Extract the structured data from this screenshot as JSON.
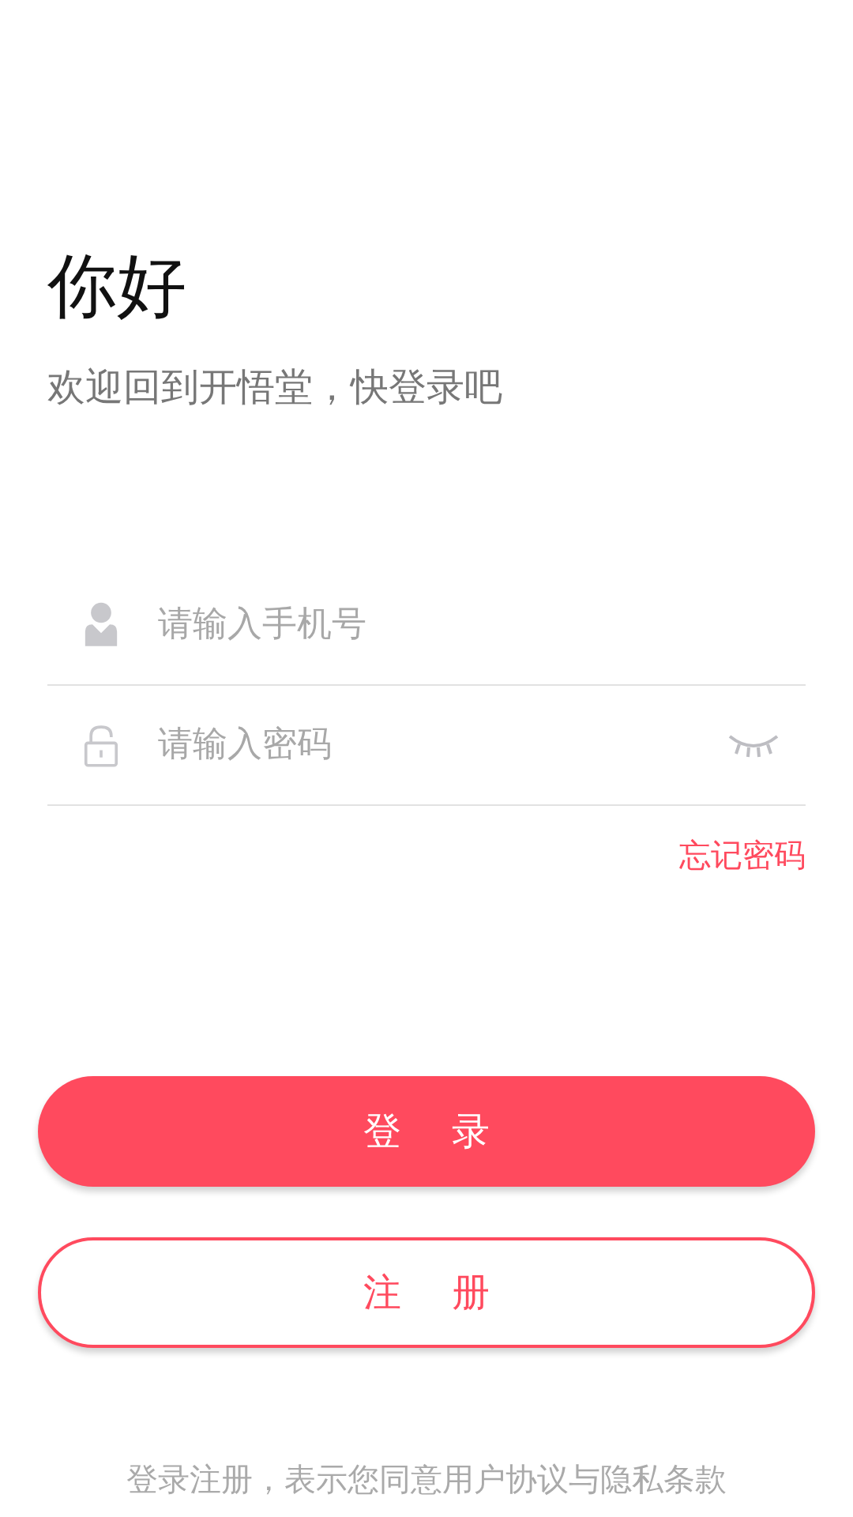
{
  "greeting": "你好",
  "subtitle": "欢迎回到开悟堂，快登录吧",
  "fields": [
    {
      "kind": "phone",
      "placeholder": "请输入手机号"
    },
    {
      "kind": "password",
      "placeholder": "请输入密码",
      "password_visible": false
    }
  ],
  "forgot_link": "忘记密码",
  "buttons": [
    {
      "kind": "primary",
      "label": "登 录"
    },
    {
      "kind": "outline",
      "label": "注 册"
    }
  ],
  "footer": "登录注册，表示您同意用户协议与隐私条款"
}
